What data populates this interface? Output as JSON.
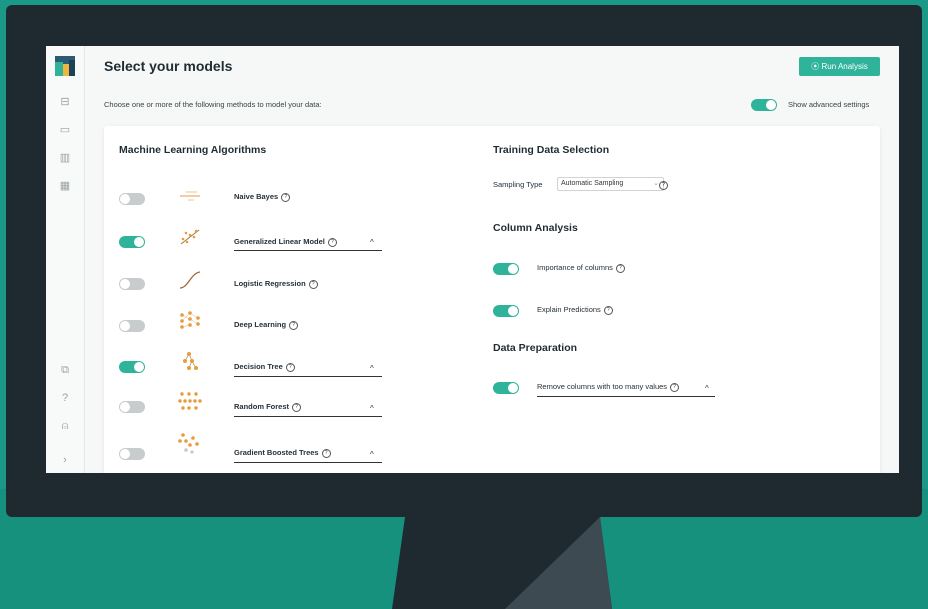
{
  "page": {
    "title": "Select your models",
    "run_button": "Run Analysis",
    "subtitle": "Choose one or more of the following methods to model your data:",
    "advanced_label": "Show advanced settings"
  },
  "ml": {
    "title": "Machine Learning Algorithms",
    "items": [
      {
        "label": "Naive Bayes",
        "on": false,
        "icon": "naive-bayes-icon"
      },
      {
        "label": "Generalized Linear Model",
        "on": true,
        "icon": "glm-icon"
      },
      {
        "label": "Logistic Regression",
        "on": false,
        "icon": "logistic-curve-icon"
      },
      {
        "label": "Deep Learning",
        "on": false,
        "icon": "neural-network-icon"
      },
      {
        "label": "Decision Tree",
        "on": true,
        "icon": "decision-tree-icon"
      },
      {
        "label": "Random Forest",
        "on": false,
        "icon": "random-forest-icon"
      },
      {
        "label": "Gradient Boosted Trees",
        "on": false,
        "icon": "gradient-boosted-icon"
      }
    ]
  },
  "training": {
    "title": "Training Data Selection",
    "sampling_label": "Sampling Type",
    "sampling_value": "Automatic Sampling"
  },
  "column_analysis": {
    "title": "Column Analysis",
    "importance": "Importance of columns",
    "explain": "Explain Predictions"
  },
  "data_prep": {
    "title": "Data Preparation",
    "remove": "Remove columns with too many values"
  },
  "colors": {
    "accent": "#2fb39b",
    "background": "#1a9a86",
    "monitor": "#1e2a30"
  }
}
